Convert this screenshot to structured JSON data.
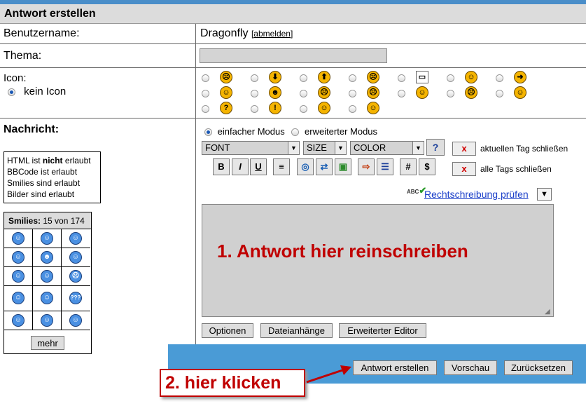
{
  "title": "Antwort erstellen",
  "user": {
    "label": "Benutzername:",
    "name": "Dragonfly",
    "logout": "[abmelden]"
  },
  "topic": {
    "label": "Thema:",
    "value": ""
  },
  "icon": {
    "label": "Icon:",
    "none_label": "kein Icon",
    "glyphs": [
      "☹",
      "⬇",
      "⬆",
      "☹",
      "▭",
      "☺",
      "➜",
      "☺",
      "☻",
      "☹",
      "☹",
      "☺",
      "☹",
      "☺",
      "?",
      "!",
      "☺",
      "☺"
    ]
  },
  "message": {
    "label": "Nachricht:",
    "mode_simple": "einfacher Modus",
    "mode_advanced": "erweiterter Modus",
    "font": "FONT",
    "size": "SIZE",
    "color": "COLOR",
    "help": "?",
    "close_tag": "aktuellen Tag schließen",
    "close_all": "alle Tags schließen",
    "close_mark": "x",
    "toolbar": [
      "B",
      "I",
      "U",
      "≡",
      "◎",
      "⇄",
      "▣",
      "⇨",
      "☰",
      "#",
      "$"
    ],
    "spellcheck": "Rechtschreibung prüfen",
    "spell_abc": "ABC",
    "annotation_text": "1. Antwort hier reinschreiben"
  },
  "info": {
    "line1_pre": "HTML ist ",
    "line1_bold": "nicht",
    "line1_post": " erlaubt",
    "line2": "BBCode ist erlaubt",
    "line3": "Smilies sind erlaubt",
    "line4": "Bilder sind erlaubt"
  },
  "smilies": {
    "label": "Smilies:",
    "count": "15 von 174",
    "more": "mehr",
    "glyphs": [
      "☺",
      "☺",
      "☺",
      "☺",
      "☻",
      "☺",
      "☺",
      "☺",
      "☹",
      "☺",
      "☺",
      "???",
      "☺",
      "☺",
      "☺"
    ]
  },
  "buttons": {
    "options": "Optionen",
    "attachments": "Dateianhänge",
    "advanced_editor": "Erweiterter Editor",
    "submit": "Antwort erstellen",
    "preview": "Vorschau",
    "reset": "Zurücksetzen"
  },
  "callout": {
    "text": "2. hier klicken"
  },
  "colors": {
    "header": "#dcdcdc",
    "blue_bar": "#4a9bd6",
    "annotation": "#c00000",
    "textarea": "#d0d0d0"
  }
}
